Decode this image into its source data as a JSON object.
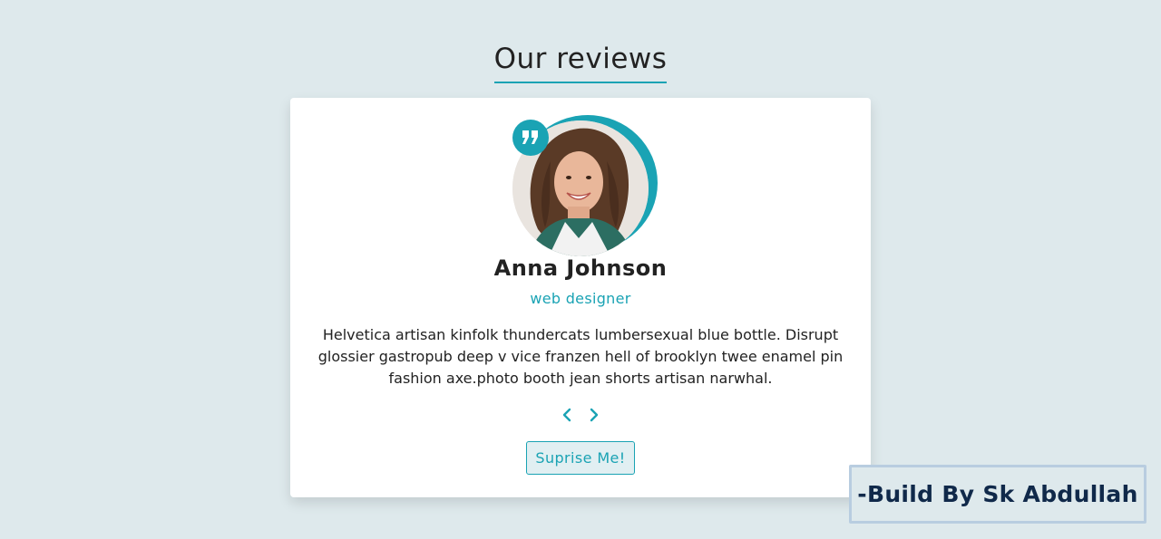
{
  "header": {
    "title": "Our reviews"
  },
  "review": {
    "name": "Anna Johnson",
    "job": "web designer",
    "text": "Helvetica artisan kinfolk thundercats lumbersexual blue bottle. Disrupt glossier gastropub deep v vice franzen hell of brooklyn twee enamel pin fashion axe.photo booth jean shorts artisan narwhal."
  },
  "controls": {
    "random_label": "Suprise Me!"
  },
  "footer": {
    "credit": "-Build By Sk Abdullah"
  },
  "colors": {
    "accent": "#1aa3b4",
    "background": "#dee9ec",
    "card": "#ffffff",
    "credit_text": "#10294a"
  },
  "icons": {
    "quote": "quote-icon",
    "prev": "chevron-left-icon",
    "next": "chevron-right-icon"
  }
}
